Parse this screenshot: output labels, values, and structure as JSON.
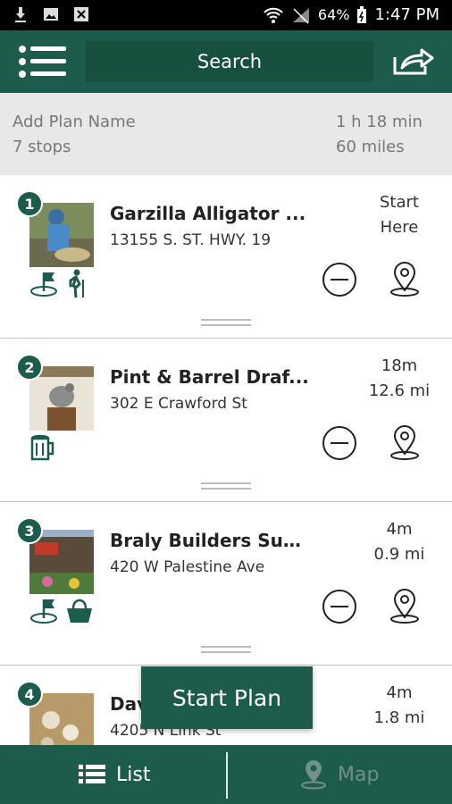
{
  "status_bar": {
    "battery": "64%",
    "time": "1:47 PM",
    "left_icons": [
      "download-icon",
      "image-icon",
      "close-box-icon"
    ],
    "right_icons": [
      "wifi-icon",
      "signal-icon",
      "battery-icon"
    ]
  },
  "app_bar": {
    "search_label": "Search",
    "menu_icon": "menu-icon",
    "share_icon": "share-icon"
  },
  "plan": {
    "name": "Add Plan Name",
    "stops": "7 stops",
    "duration": "1 h 18 min",
    "distance": "60 miles"
  },
  "stops": [
    {
      "number": "1",
      "title": "Garzilla Alligator ...",
      "address": "13155 S. ST. HWY. 19",
      "dist_line1": "Start",
      "dist_line2": "Here",
      "categories": [
        "flag-icon",
        "hiker-icon"
      ]
    },
    {
      "number": "2",
      "title": "Pint & Barrel Draf...",
      "address": "302 E Crawford St",
      "dist_line1": "18m",
      "dist_line2": "12.6 mi",
      "categories": [
        "beer-mug-icon"
      ]
    },
    {
      "number": "3",
      "title": "Braly Builders Sup...",
      "address": "420 W Palestine Ave",
      "dist_line1": "4m",
      "dist_line2": "0.9 mi",
      "categories": [
        "flag-icon",
        "basket-icon"
      ]
    },
    {
      "number": "4",
      "title": "Dav",
      "address": "4205 N Link St",
      "dist_line1": "4m",
      "dist_line2": "1.8 mi",
      "categories": []
    }
  ],
  "start_plan_label": "Start Plan",
  "tabs": {
    "list_label": "List",
    "map_label": "Map"
  },
  "colors": {
    "primary": "#1d5b4d",
    "header_bg": "#e8e8e8",
    "inactive_tab": "#6f9187"
  }
}
